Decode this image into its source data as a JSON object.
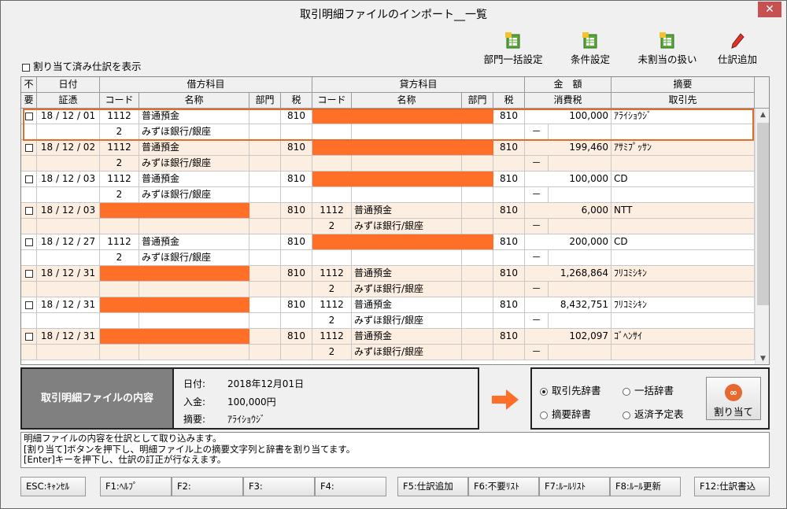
{
  "window": {
    "title": "取引明細ファイルのインポート__一覧",
    "close_label": "✕"
  },
  "toolbar": {
    "dept_bulk_label": "部門一括設定",
    "condition_label": "条件設定",
    "unassigned_label": "未割当の扱い",
    "add_entry_label": "仕訳追加"
  },
  "show_assigned_label": "割り当て済み仕訳を表示",
  "grid": {
    "headers": {
      "unneeded_top": "不",
      "unneeded_bottom": "要",
      "date": "日付",
      "voucher": "証憑",
      "debit": "借方科目",
      "credit": "貸方科目",
      "code": "コード",
      "name": "名称",
      "dept": "部門",
      "tax": "税",
      "amount": "金　額",
      "consumption_tax": "消費税",
      "summary": "摘要",
      "partner": "取引先"
    },
    "rows": [
      {
        "date": "18 / 12 / 01",
        "dc": "1112",
        "dn": "普通預金",
        "dt": "810",
        "dc2": "2",
        "dn2": "みずほ銀行/銀座",
        "cc": "",
        "cn": "",
        "ct": "810",
        "cc2": "",
        "cn2": "",
        "amount": "100,000",
        "tax": "－",
        "partner": "ｱﾗｲｼｮｳｼﾞ",
        "debit_missing": false,
        "credit_missing": true
      },
      {
        "date": "18 / 12 / 02",
        "dc": "1112",
        "dn": "普通預金",
        "dt": "810",
        "dc2": "2",
        "dn2": "みずほ銀行/銀座",
        "cc": "",
        "cn": "",
        "ct": "810",
        "cc2": "",
        "cn2": "",
        "amount": "199,460",
        "tax": "－",
        "partner": "ｱｻﾐﾌﾟｯｻﾝ",
        "debit_missing": false,
        "credit_missing": true
      },
      {
        "date": "18 / 12 / 03",
        "dc": "1112",
        "dn": "普通預金",
        "dt": "810",
        "dc2": "2",
        "dn2": "みずほ銀行/銀座",
        "cc": "",
        "cn": "",
        "ct": "810",
        "cc2": "",
        "cn2": "",
        "amount": "100,000",
        "tax": "－",
        "partner": "CD",
        "debit_missing": false,
        "credit_missing": true
      },
      {
        "date": "18 / 12 / 03",
        "dc": "",
        "dn": "",
        "dt": "810",
        "dc2": "",
        "dn2": "",
        "cc": "1112",
        "cn": "普通預金",
        "ct": "810",
        "cc2": "2",
        "cn2": "みずほ銀行/銀座",
        "amount": "6,000",
        "tax": "－",
        "partner": "NTT",
        "debit_missing": true,
        "credit_missing": false
      },
      {
        "date": "18 / 12 / 27",
        "dc": "1112",
        "dn": "普通預金",
        "dt": "810",
        "dc2": "2",
        "dn2": "みずほ銀行/銀座",
        "cc": "",
        "cn": "",
        "ct": "810",
        "cc2": "",
        "cn2": "",
        "amount": "200,000",
        "tax": "－",
        "partner": "CD",
        "debit_missing": false,
        "credit_missing": true
      },
      {
        "date": "18 / 12 / 31",
        "dc": "",
        "dn": "",
        "dt": "810",
        "dc2": "",
        "dn2": "",
        "cc": "1112",
        "cn": "普通預金",
        "ct": "810",
        "cc2": "2",
        "cn2": "みずほ銀行/銀座",
        "amount": "1,268,864",
        "tax": "－",
        "partner": "ﾌﾘｺﾐｼｷﾝ",
        "debit_missing": true,
        "credit_missing": false
      },
      {
        "date": "18 / 12 / 31",
        "dc": "",
        "dn": "",
        "dt": "810",
        "dc2": "",
        "dn2": "",
        "cc": "1112",
        "cn": "普通預金",
        "ct": "810",
        "cc2": "2",
        "cn2": "みずほ銀行/銀座",
        "amount": "8,432,751",
        "tax": "－",
        "partner": "ﾌﾘｺﾐｼｷﾝ",
        "debit_missing": true,
        "credit_missing": false
      },
      {
        "date": "18 / 12 / 31",
        "dc": "",
        "dn": "",
        "dt": "810",
        "dc2": "",
        "dn2": "",
        "cc": "1112",
        "cn": "普通預金",
        "ct": "810",
        "cc2": "2",
        "cn2": "みずほ銀行/銀座",
        "amount": "102,097",
        "tax": "－",
        "partner": "ｺﾞﾍﾝｻｲ",
        "debit_missing": true,
        "credit_missing": false
      }
    ]
  },
  "detail": {
    "title": "取引明細ファイルの内容",
    "date_label": "日付:",
    "date_value": "2018年12月01日",
    "deposit_label": "入金:",
    "deposit_value": "100,000円",
    "summary_label": "摘要:",
    "summary_value": "ｱﾗｲｼｮｳｼﾞ"
  },
  "options": {
    "partner_dict": "取引先辞書",
    "bulk_dict": "一括辞書",
    "summary_dict": "摘要辞書",
    "repay_table": "返済予定表",
    "assign_label": "割り当て"
  },
  "messages": [
    "明細ファイルの内容を仕訳として取り込みます。",
    "[割り当て]ボタンを押下し、明細ファイル上の摘要文字列と辞書を割り当てます。",
    "[Enter]キーを押下し、仕訳の訂正が行なえます。"
  ],
  "fkeys": [
    "ESC:ｷｬﾝｾﾙ",
    "F1:ﾍﾙﾌﾟ",
    "F2:",
    "F3:",
    "F4:",
    "F5:仕訳追加",
    "F6:不要ﾘｽﾄ",
    "F7:ﾙｰﾙﾘｽﾄ",
    "F8:ﾙｰﾙ更新",
    "F12:仕訳書込"
  ],
  "colors": {
    "missing": "#ff6f28",
    "alt_row": "#fdeee2",
    "selection": "#e36c2a"
  }
}
